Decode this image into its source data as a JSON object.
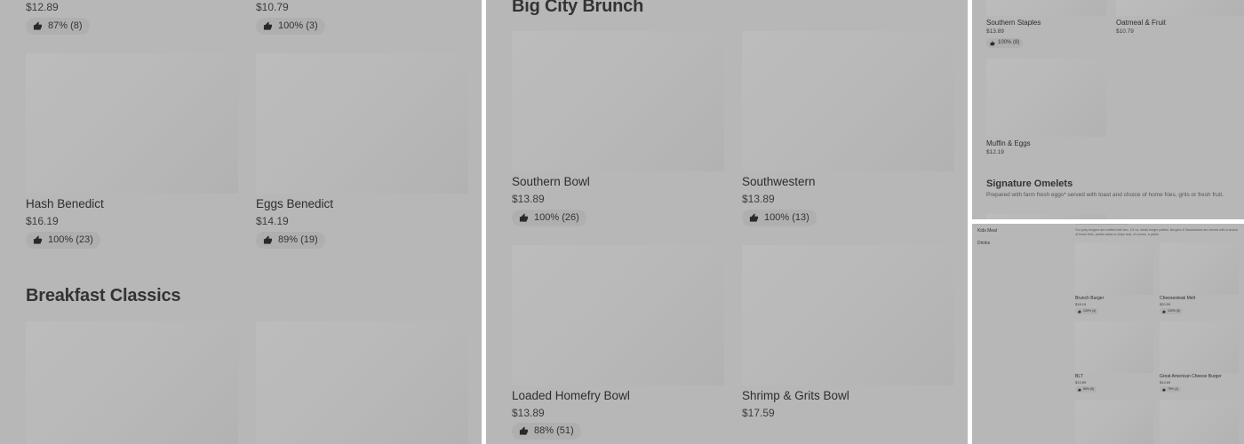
{
  "panel1": {
    "top_items": [
      {
        "price": "$12.89",
        "rating": "87% (8)"
      },
      {
        "price": "$10.79",
        "rating": "100% (3)"
      }
    ],
    "items": [
      {
        "name": "Hash Benedict",
        "price": "$16.19",
        "rating": "100% (23)"
      },
      {
        "name": "Eggs Benedict",
        "price": "$14.19",
        "rating": "89% (19)"
      }
    ],
    "section_title": "Breakfast Classics"
  },
  "panel2": {
    "section_title": "Big City Brunch",
    "items": [
      {
        "name": "Southern Bowl",
        "price": "$13.89",
        "rating": "100% (26)"
      },
      {
        "name": "Southwestern",
        "price": "$13.89",
        "rating": "100% (13)"
      },
      {
        "name": "Loaded Homefry Bowl",
        "price": "$13.89",
        "rating": "88% (51)"
      },
      {
        "name": "Shrimp & Grits Bowl",
        "price": "$17.59",
        "rating": ""
      }
    ]
  },
  "panel3": {
    "items": [
      {
        "name": "Southern Staples",
        "price": "$13.89",
        "rating": "100% (8)"
      },
      {
        "name": "Oatmeal & Fruit",
        "price": "$10.79",
        "rating": ""
      },
      {
        "name": "Muffin & Eggs",
        "price": "$12.19",
        "rating": ""
      }
    ],
    "section_title": "Signature Omelets",
    "section_desc": "Prepared with farm fresh eggs* served with toast and choice of home fries, grits or fresh fruit."
  },
  "panel4": {
    "sidebar": [
      "Kids Meal",
      "Drinks"
    ],
    "section_desc": "Our juicy burgers are crafted with two, 1/4 oz. steak burger patties. Burgers & Sandwiches are served with a choice of home fries, potato salad or chips and, of course, a pickle.",
    "items": [
      {
        "name": "Brunch Burger",
        "price": "$18.19",
        "rating": "100% (4)"
      },
      {
        "name": "Cheesesteak Melt",
        "price": "$20.59",
        "rating": "100% (8)"
      },
      {
        "name": "BLT",
        "price": "$13.89",
        "rating": "88% (8)"
      },
      {
        "name": "Great American Cheese Burger",
        "price": "$14.69",
        "rating": "75% (4)"
      }
    ]
  },
  "icons": {
    "rating": "thumbs-up-icon"
  },
  "colors": {
    "panel_bg": "#b7b7b7",
    "image_placeholder": "#bababa",
    "badge_bg": "#afafaf"
  }
}
